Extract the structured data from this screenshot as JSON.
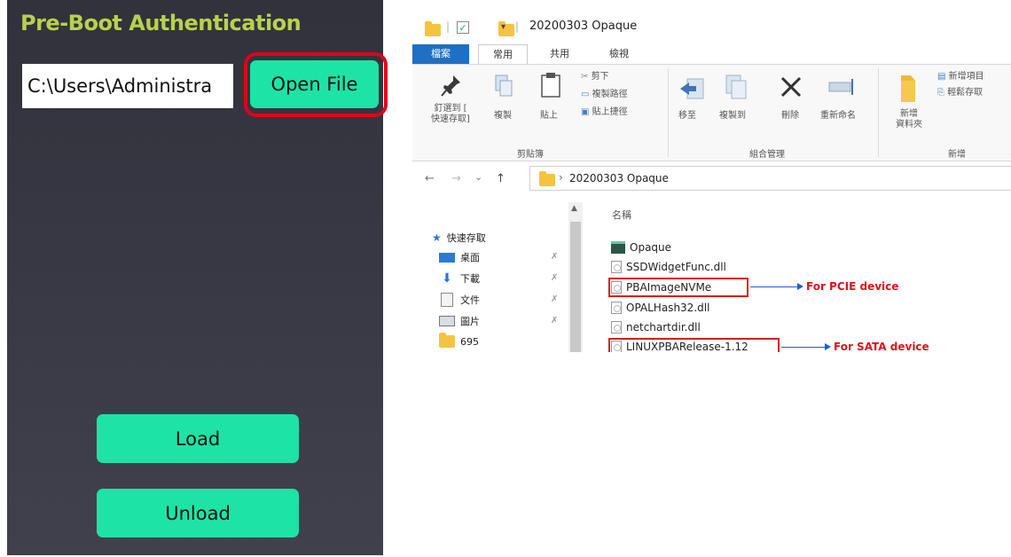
{
  "pba_panel": {
    "title": "Pre-Boot Authentication",
    "path_value": "C:\\Users\\Administra",
    "open_file_label": "Open File",
    "load_label": "Load",
    "unload_label": "Unload",
    "colors": {
      "panel_bg": "#383844",
      "title": "#b7d24a",
      "button": "#1de3a6",
      "highlight": "#e0001a"
    }
  },
  "explorer": {
    "window_title": "20200303 Opaque",
    "quick_access_separator": "|",
    "quick_access_dropdown": "▾",
    "ribbon_tabs": [
      "檔案",
      "常用",
      "共用",
      "檢視"
    ],
    "ribbon": {
      "clipboard": {
        "pin_label": "釘選到 [\n快速存取]",
        "copy_label": "複製",
        "paste_label": "貼上",
        "cut_label": "剪下",
        "copy_path_label": "複製路徑",
        "paste_shortcut_label": "貼上捷徑",
        "group_label": "剪貼簿"
      },
      "organize": {
        "move_to_label": "移至",
        "copy_to_label": "複製到",
        "delete_label": "刪除",
        "rename_label": "重新命名",
        "group_label": "組合管理"
      },
      "new": {
        "new_folder_label": "新增\n資料夾",
        "new_item_label": "新增項目",
        "easy_access_label": "輕鬆存取",
        "group_label": "新增"
      }
    },
    "address": {
      "back": "←",
      "forward": "→",
      "recent": "⌄",
      "up": "↑",
      "path_separator": "›",
      "path": "20200303 Opaque"
    },
    "nav_pane": [
      {
        "label": "快速存取",
        "icon": "star-icon"
      },
      {
        "label": "桌面",
        "icon": "desktop-icon"
      },
      {
        "label": "下載",
        "icon": "download-icon"
      },
      {
        "label": "文件",
        "icon": "document-icon"
      },
      {
        "label": "圖片",
        "icon": "picture-icon"
      },
      {
        "label": "695",
        "icon": "folder-icon"
      }
    ],
    "files_header": "名稱",
    "files": [
      {
        "name": "Opaque",
        "icon": "app-icon"
      },
      {
        "name": "SSDWidgetFunc.dll",
        "icon": "dll-icon"
      },
      {
        "name": "PBAImageNVMe",
        "icon": "file-icon"
      },
      {
        "name": "OPALHash32.dll",
        "icon": "dll-icon"
      },
      {
        "name": "netchartdir.dll",
        "icon": "dll-icon"
      },
      {
        "name": "LINUXPBARelease-1.12",
        "icon": "file-icon"
      }
    ],
    "annotations": {
      "pcie": "For PCIE device",
      "sata": "For SATA device"
    },
    "colors": {
      "file_tab": "#1f6fc4",
      "annotation_text": "#e0101a",
      "annotation_arrow": "#1e5fd0",
      "annotation_box": "#d81d1d"
    }
  }
}
